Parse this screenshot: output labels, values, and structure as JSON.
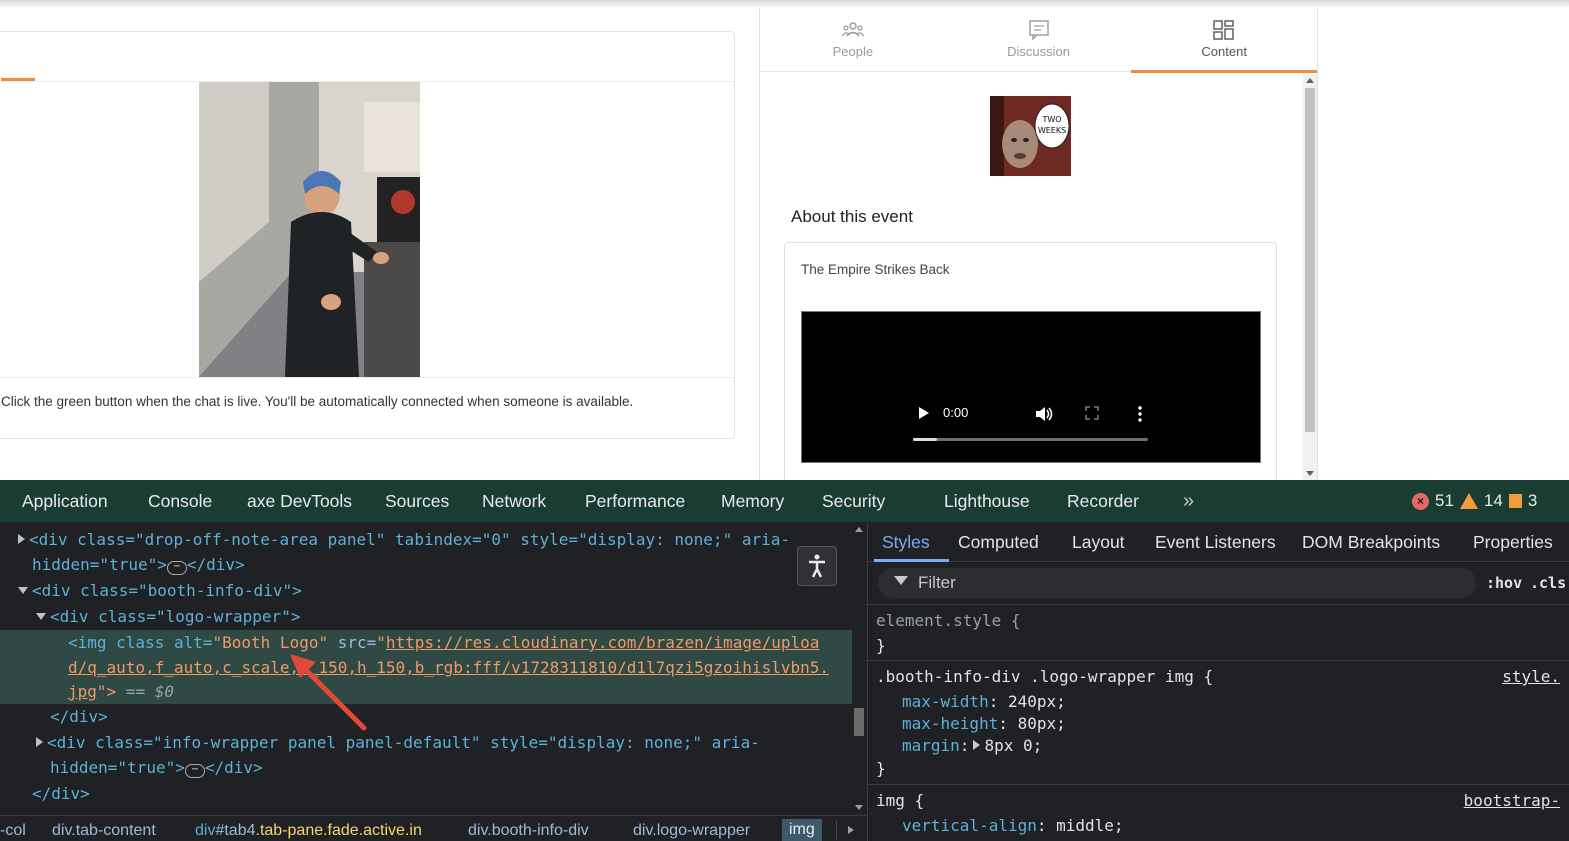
{
  "app": {
    "chat_note": "Click the green button when the chat is live. You'll be automatically connected when someone is available.",
    "tabs": [
      {
        "label": "People",
        "icon": "people-icon"
      },
      {
        "label": "Discussion",
        "icon": "discussion-icon"
      },
      {
        "label": "Content",
        "icon": "content-grid-icon",
        "active": true
      }
    ],
    "logo_text": "TWO WEEKS",
    "about_title": "About this event",
    "about_text": "The Empire Strikes Back",
    "video": {
      "time": "0:00",
      "progress": 0.1
    }
  },
  "devtools": {
    "tabs": [
      "Application",
      "Console",
      "axe DevTools",
      "Sources",
      "Network",
      "Performance",
      "Memory",
      "Security",
      "Lighthouse",
      "Recorder"
    ],
    "errors": "51",
    "warnings": "14",
    "issues": "3",
    "dom": {
      "l1_a": "<div class=\"drop-off-note-area panel\" tabindex=\"0\" style=\"display: none;\" aria-",
      "l1_b": "hidden=\"true\">",
      "l1_c": "</div>",
      "l2": "<div class=\"booth-info-div\">",
      "l3": "<div class=\"logo-wrapper\">",
      "img_open": "<img class alt=",
      "img_alt": "\"Booth Logo\"",
      "img_src_attr": " src=",
      "img_url_1": "https://res.cloudinary.com/brazen/image/uploa",
      "img_url_2": "d/q_auto,f_auto,c_scale,w_150,h_150,b_rgb:fff/v1728311810/d1l7qzi5gzoihislvbn5.",
      "img_url_3": "jpg",
      "img_close": "\">",
      "img_eq": " == $0",
      "l5": "</div>",
      "l6_a": "<div class=\"info-wrapper panel panel-default\" style=\"display: none;\" aria-",
      "l6_b": "hidden=\"true\">",
      "l6_c": "</div>",
      "l7": "</div>"
    },
    "breadcrumbs": [
      {
        "text": "-col"
      },
      {
        "text": "div.tab-content"
      },
      {
        "tag": "div",
        "id": "#tab4",
        "cls": ".tab-pane.fade.active.in"
      },
      {
        "text": "div.booth-info-div"
      },
      {
        "text": "div.logo-wrapper"
      },
      {
        "text": "img",
        "active": true
      }
    ],
    "styles_tabs": [
      "Styles",
      "Computed",
      "Layout",
      "Event Listeners",
      "DOM Breakpoints",
      "Properties"
    ],
    "filter_placeholder": "Filter",
    "hov": ":hov",
    "cls": ".cls",
    "rules": {
      "element_style": "element.style {",
      "close": "}",
      "r2_selector": ".booth-info-div .logo-wrapper img {",
      "r2_source": "style.",
      "r2_p1": "max-width",
      "r2_v1": "240px;",
      "r2_p2": "max-height",
      "r2_v2": "80px;",
      "r2_p3": "margin",
      "r2_v3": "8px 0;",
      "r3_selector": "img {",
      "r3_source": "bootstrap-",
      "r3_p1": "vertical-align",
      "r3_v1": "middle;"
    }
  }
}
